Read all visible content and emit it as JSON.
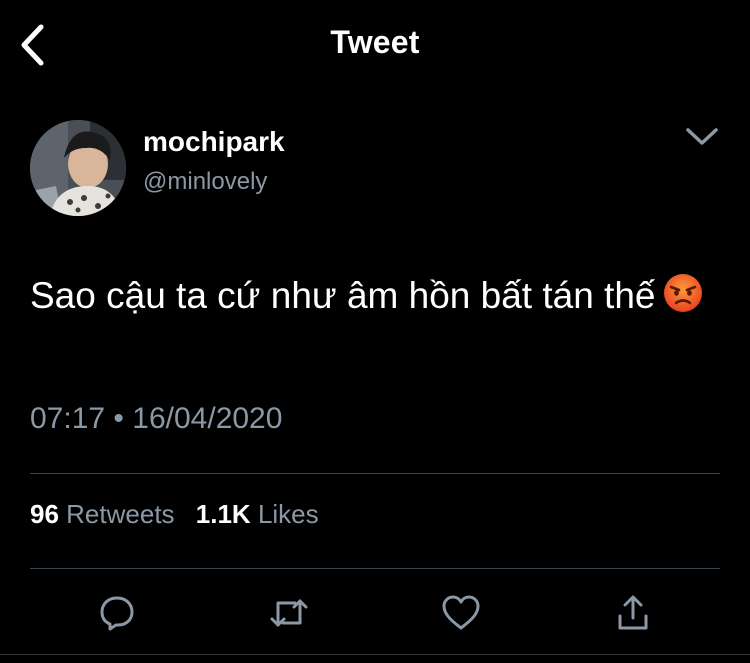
{
  "header": {
    "title": "Tweet",
    "back_icon": "chevron-left-icon"
  },
  "author": {
    "display_name": "mochipark",
    "handle": "@minlovely",
    "menu_icon": "chevron-down-icon"
  },
  "tweet": {
    "text": "Sao cậu ta cứ như âm hồn bất tán thế",
    "emoji": "angry-face-emoji",
    "time": "07:17",
    "separator": "•",
    "date": "16/04/2020"
  },
  "stats": {
    "retweets_count": "96",
    "retweets_label": "Retweets",
    "likes_count": "1.1K",
    "likes_label": "Likes"
  },
  "actions": {
    "icons": [
      "reply-icon",
      "retweet-icon",
      "like-icon",
      "share-icon"
    ]
  },
  "colors": {
    "background": "#000000",
    "text": "#ffffff",
    "secondary_text": "#8b98a5",
    "divider": "#38444d",
    "accent": "#1da1f2"
  }
}
